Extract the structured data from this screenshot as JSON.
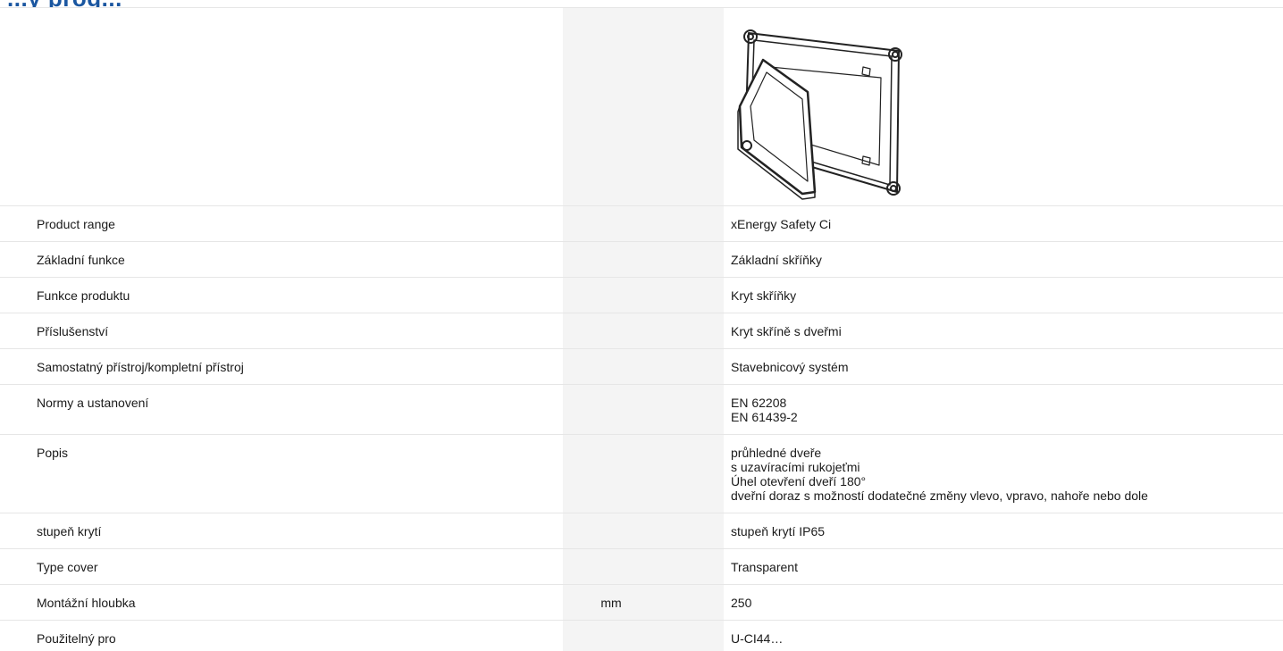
{
  "heading": "...y prog...",
  "rows": [
    {
      "label": "Product range",
      "unit": "",
      "values": [
        "xEnergy Safety Ci"
      ]
    },
    {
      "label": "Základní funkce",
      "unit": "",
      "values": [
        "Základní skříňky"
      ]
    },
    {
      "label": "Funkce produktu",
      "unit": "",
      "values": [
        "Kryt skříňky"
      ]
    },
    {
      "label": "Příslušenství",
      "unit": "",
      "values": [
        "Kryt skříně s dveřmi"
      ]
    },
    {
      "label": "Samostatný přístroj/kompletní přístroj",
      "unit": "",
      "values": [
        "Stavebnicový systém"
      ]
    },
    {
      "label": "Normy a ustanovení",
      "unit": "",
      "values": [
        "EN 62208",
        "EN 61439-2"
      ]
    },
    {
      "label": "Popis",
      "unit": "",
      "values": [
        "průhledné dveře",
        "s uzavíracími rukojeťmi",
        "Úhel otevření dveří 180°",
        "dveřní doraz s možností dodatečné změny vlevo, vpravo, nahoře nebo dole"
      ]
    },
    {
      "label": "stupeň krytí",
      "unit": "",
      "values": [
        "stupeň krytí IP65"
      ]
    },
    {
      "label": "Type cover",
      "unit": "",
      "values": [
        "Transparent"
      ]
    },
    {
      "label": "Montážní hloubka",
      "unit": "mm",
      "values": [
        "250"
      ]
    },
    {
      "label": "Použitelný pro",
      "unit": "",
      "values": [
        "U-CI44…"
      ]
    }
  ],
  "image": {
    "icon": "enclosure-cover-drawing-icon"
  },
  "colors": {
    "heading": "#1a56a0",
    "shade": "#f4f4f4",
    "border": "#e6e6e6"
  }
}
